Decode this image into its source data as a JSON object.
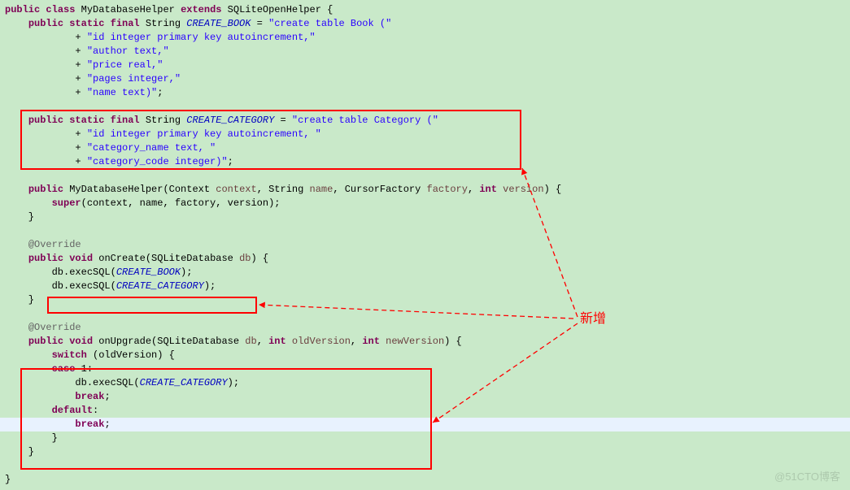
{
  "code": {
    "l1_public": "public",
    "l1_class": "class",
    "l1_name": " MyDatabaseHelper ",
    "l1_extends": "extends",
    "l1_super": " SQLiteOpenHelper {",
    "l2_pre": "    ",
    "l2_psf": "public static final",
    "l2_type": " String ",
    "l2_const": "CREATE_BOOK",
    "l2_eq": " = ",
    "l2_str": "\"create table Book (\"",
    "l3_pre": "            + ",
    "l3_str": "\"id integer primary key autoincrement,\"",
    "l4_pre": "            + ",
    "l4_str": "\"author text,\"",
    "l5_pre": "            + ",
    "l5_str": "\"price real,\"",
    "l6_pre": "            + ",
    "l6_str": "\"pages integer,\"",
    "l7_pre": "            + ",
    "l7_str": "\"name text)\"",
    "l7_end": ";",
    "blank": " ",
    "l9_pre": "    ",
    "l9_psf": "public static final",
    "l9_type": " String ",
    "l9_const": "CREATE_CATEGORY",
    "l9_eq": " = ",
    "l9_str": "\"create table Category (\"",
    "l10_pre": "            + ",
    "l10_str": "\"id integer primary key autoincrement, \"",
    "l11_pre": "            + ",
    "l11_str": "\"category_name text, \"",
    "l12_pre": "            + ",
    "l12_str": "\"category_code integer)\"",
    "l12_end": ";",
    "l14_pre": "    ",
    "l14_public": "public",
    "l14_name": " MyDatabaseHelper(Context ",
    "l14_arg1": "context",
    "l14_mid1": ", String ",
    "l14_arg2": "name",
    "l14_mid2": ", CursorFactory ",
    "l14_arg3": "factory",
    "l14_mid3": ", ",
    "l14_int": "int",
    "l14_sp": " ",
    "l14_arg4": "version",
    "l14_end": ") {",
    "l15_pre": "        ",
    "l15_super": "super",
    "l15_rest": "(context, name, factory, version);",
    "l16_brace": "    }",
    "l18_pre": "    ",
    "l18_ann": "@Override",
    "l19_pre": "    ",
    "l19_public": "public",
    "l19_sp": " ",
    "l19_void": "void",
    "l19_rest": " onCreate(SQLiteDatabase ",
    "l19_arg": "db",
    "l19_end": ") {",
    "l20_pre": "        db.execSQL(",
    "l20_const": "CREATE_BOOK",
    "l20_end": ");",
    "l21_pre": "        db.execSQL(",
    "l21_const": "CREATE_CATEGORY",
    "l21_end": ");",
    "l22_brace": "    }",
    "l24_pre": "    ",
    "l24_ann": "@Override",
    "l25_pre": "    ",
    "l25_public": "public",
    "l25_sp": " ",
    "l25_void": "void",
    "l25_rest": " onUpgrade(SQLiteDatabase ",
    "l25_arg1": "db",
    "l25_mid1": ", ",
    "l25_int": "int",
    "l25_sp2": " ",
    "l25_arg2": "oldVersion",
    "l25_mid2": ", ",
    "l25_int2": "int",
    "l25_sp3": " ",
    "l25_arg3": "newVersion",
    "l25_end": ") {",
    "l26_pre": "        ",
    "l26_switch": "switch",
    "l26_rest": " (oldVersion) {",
    "l27_pre": "        ",
    "l27_case": "case",
    "l27_rest": " 1:",
    "l28_pre": "            db.execSQL(",
    "l28_const": "CREATE_CATEGORY",
    "l28_end": ");",
    "l29_pre": "            ",
    "l29_break": "break",
    "l29_end": ";",
    "l30_pre": "        ",
    "l30_default": "default",
    "l30_end": ":",
    "l31_pre": "            ",
    "l31_break": "break",
    "l31_end": ";",
    "l32_brace": "        }",
    "l33_brace": "    }",
    "l35_brace": "}"
  },
  "label": {
    "xinzeng": "新增"
  },
  "watermark": "@51CTO博客"
}
